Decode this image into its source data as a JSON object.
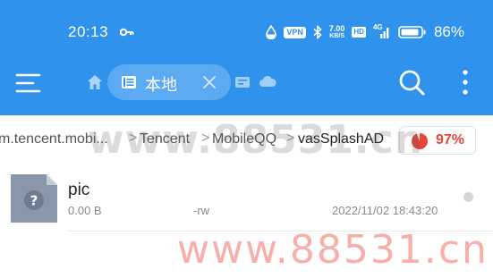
{
  "status_bar": {
    "time": "20:13",
    "vpn_label": "VPN",
    "net_speed_value": "7.00",
    "net_speed_unit": "KB/S",
    "hd_label": "HD",
    "signal_label": "4G",
    "battery_percent": "86%"
  },
  "toolbar": {
    "active_tab_label": "本地",
    "icons": [
      "menu-icon",
      "home-icon",
      "phone-storage-icon",
      "close-icon",
      "drive-icon",
      "cloud-icon",
      "search-icon",
      "more-vert-icon"
    ]
  },
  "path": {
    "crumbs": [
      "m.tencent.mobi...",
      "Tencent",
      "MobileQQ",
      "vasSplashAD"
    ],
    "separator": ">",
    "storage_used": "97%",
    "storage_used_value": 0.97
  },
  "files": [
    {
      "name": "pic",
      "size": "0.00 B",
      "permissions": "-rw",
      "modified": "2022/11/02 18:43:20",
      "icon": "unknown-file-icon"
    }
  ],
  "watermark": {
    "text": "www.88531.cn"
  },
  "colors": {
    "header_blue": "#2f93ee",
    "storage_red": "#e8443a",
    "file_icon_gray": "#8a96aa"
  }
}
